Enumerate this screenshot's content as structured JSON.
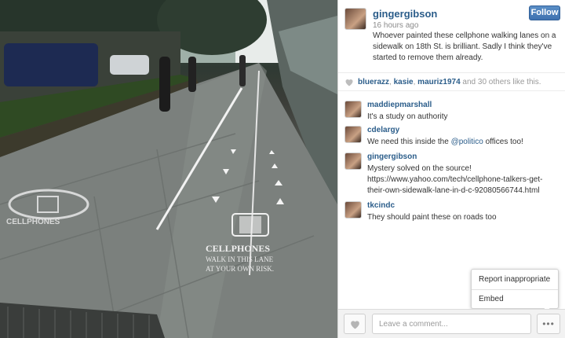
{
  "post": {
    "username": "gingergibson",
    "time_ago": "16 hours ago",
    "caption": "Whoever painted these cellphone walking lanes on a sidewalk on 18th St. is brilliant. Sadly I think they've started to remove them already.",
    "follow_label": "Follow"
  },
  "photo": {
    "stencil_left": "CELLPHONES",
    "stencil_right_title": "CELLPHONES",
    "stencil_right_line1": "WALK IN THIS LANE",
    "stencil_right_line2": "AT YOUR OWN RISK."
  },
  "likes": {
    "user1": "bluerazz",
    "sep1": ", ",
    "user2": "kasie",
    "sep2": ", ",
    "user3": "mauriz1974",
    "and": " and ",
    "others": "30 others",
    "suffix": " like this."
  },
  "comments": [
    {
      "user": "maddiepmarshall",
      "text": "It's a study on authority"
    },
    {
      "user": "cdelargy",
      "text_before": "We need this inside the ",
      "mention": "@politico",
      "text_after": " offices too!"
    },
    {
      "user": "gingergibson",
      "text": "Mystery solved on the source! https://www.yahoo.com/tech/cellphone-talkers-get-their-own-sidewalk-lane-in-d-c-92080566744.html"
    },
    {
      "user": "tkcindc",
      "text": "They should paint these on roads too"
    }
  ],
  "menu": {
    "report": "Report inappropriate",
    "embed": "Embed"
  },
  "footer": {
    "comment_placeholder": "Leave a comment...",
    "more_label": "•••"
  },
  "colors": {
    "link": "#2b5d8a",
    "follow_button": "#3f72b0"
  },
  "icons": {
    "like": "heart-icon",
    "likes_summary": "heart-icon",
    "more": "ellipsis-icon"
  }
}
